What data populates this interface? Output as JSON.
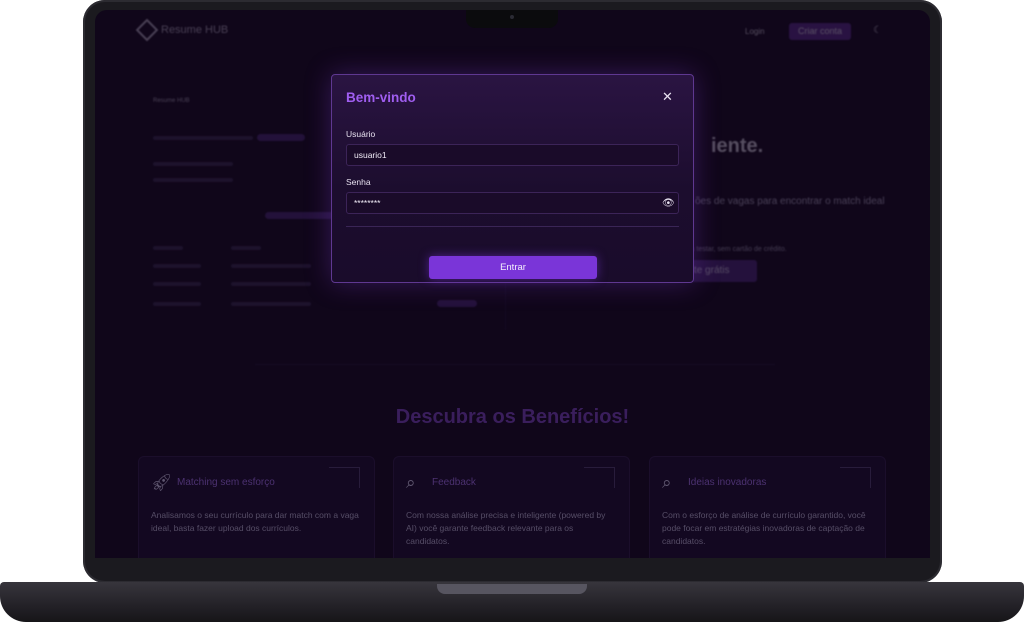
{
  "header": {
    "brand": "Resume HUB",
    "login": "Login",
    "create_account": "Criar conta",
    "theme_icon": "moon-icon"
  },
  "background": {
    "mock_brand": "Resume HUB",
    "hero_title": "iente.",
    "hero_subtitle": "ões de vagas para encontrar o match ideal",
    "hero_note": "s para testar, sem cartão de crédito.",
    "hero_cta": "r teste grátis",
    "benefits_title": "Descubra os Benefícios!",
    "benefits": [
      {
        "icon": "rocket-icon",
        "title": "Matching sem esforço",
        "desc": "Analisamos o seu currículo para dar match com a vaga ideal, basta fazer upload dos currículos."
      },
      {
        "icon": "search-icon",
        "title": "Feedback",
        "desc": "Com nossa análise precisa e inteligente (powered by AI) você garante feedback relevante para os candidatos."
      },
      {
        "icon": "search-icon",
        "title": "Ideias inovadoras",
        "desc": "Com o esforço de análise de currículo garantido, você pode focar em estratégias inovadoras de captação de candidatos."
      }
    ]
  },
  "modal": {
    "title": "Bem-vindo",
    "username_label": "Usuário",
    "username_value": "usuario1",
    "password_label": "Senha",
    "password_value": "********",
    "submit_label": "Entrar",
    "close_icon": "close-icon",
    "eye_icon": "eye-icon"
  },
  "colors": {
    "accent": "#7a35d8",
    "title_accent": "#a05ef0",
    "screen_bg": "#14081f"
  }
}
